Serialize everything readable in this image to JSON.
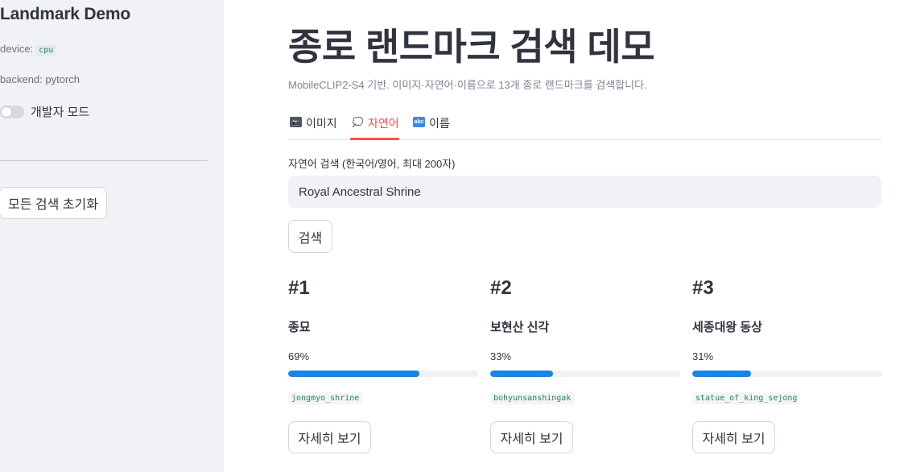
{
  "sidebar": {
    "title": "Landmark Demo",
    "device_label": "device:",
    "device_value": "cpu",
    "backend_text": "backend: pytorch",
    "dev_mode_label": "개발자 모드",
    "dev_mode_on": false,
    "reset_button": "모든 검색 초기화"
  },
  "main": {
    "title": "종로 랜드마크 검색 데모",
    "subtitle": "MobileCLIP2-S4 기반. 이미지·자연어·이름으로 13개 종로 랜드마크를 검색합니다.",
    "tabs": [
      {
        "icon": "camera-icon",
        "glyph": "📷",
        "label": "이미지",
        "active": false
      },
      {
        "icon": "speech-bubble-icon",
        "glyph": "💭",
        "label": "자연어",
        "active": true
      },
      {
        "icon": "abc-icon",
        "glyph": "abc",
        "label": "이름",
        "active": false
      }
    ],
    "search": {
      "label": "자연어 검색 (한국어/영어, 최대 200자)",
      "value": "Royal Ancestral Shrine",
      "button": "검색"
    },
    "results": [
      {
        "rank": "#1",
        "name": "종묘",
        "score_text": "69%",
        "score": 0.69,
        "slug": "jongmyo_shrine",
        "button": "자세히 보기"
      },
      {
        "rank": "#2",
        "name": "보현산 신각",
        "score_text": "33%",
        "score": 0.33,
        "slug": "bohyunsanshingak",
        "button": "자세히 보기"
      },
      {
        "rank": "#3",
        "name": "세종대왕 동상",
        "score_text": "31%",
        "score": 0.31,
        "slug": "statue_of_king_sejong",
        "button": "자세히 보기"
      }
    ]
  },
  "colors": {
    "accent": "#ff4b4b",
    "progress": "#1c83e1",
    "sidebar_bg": "#f0f2f6",
    "code_text": "#1b8a4a"
  }
}
